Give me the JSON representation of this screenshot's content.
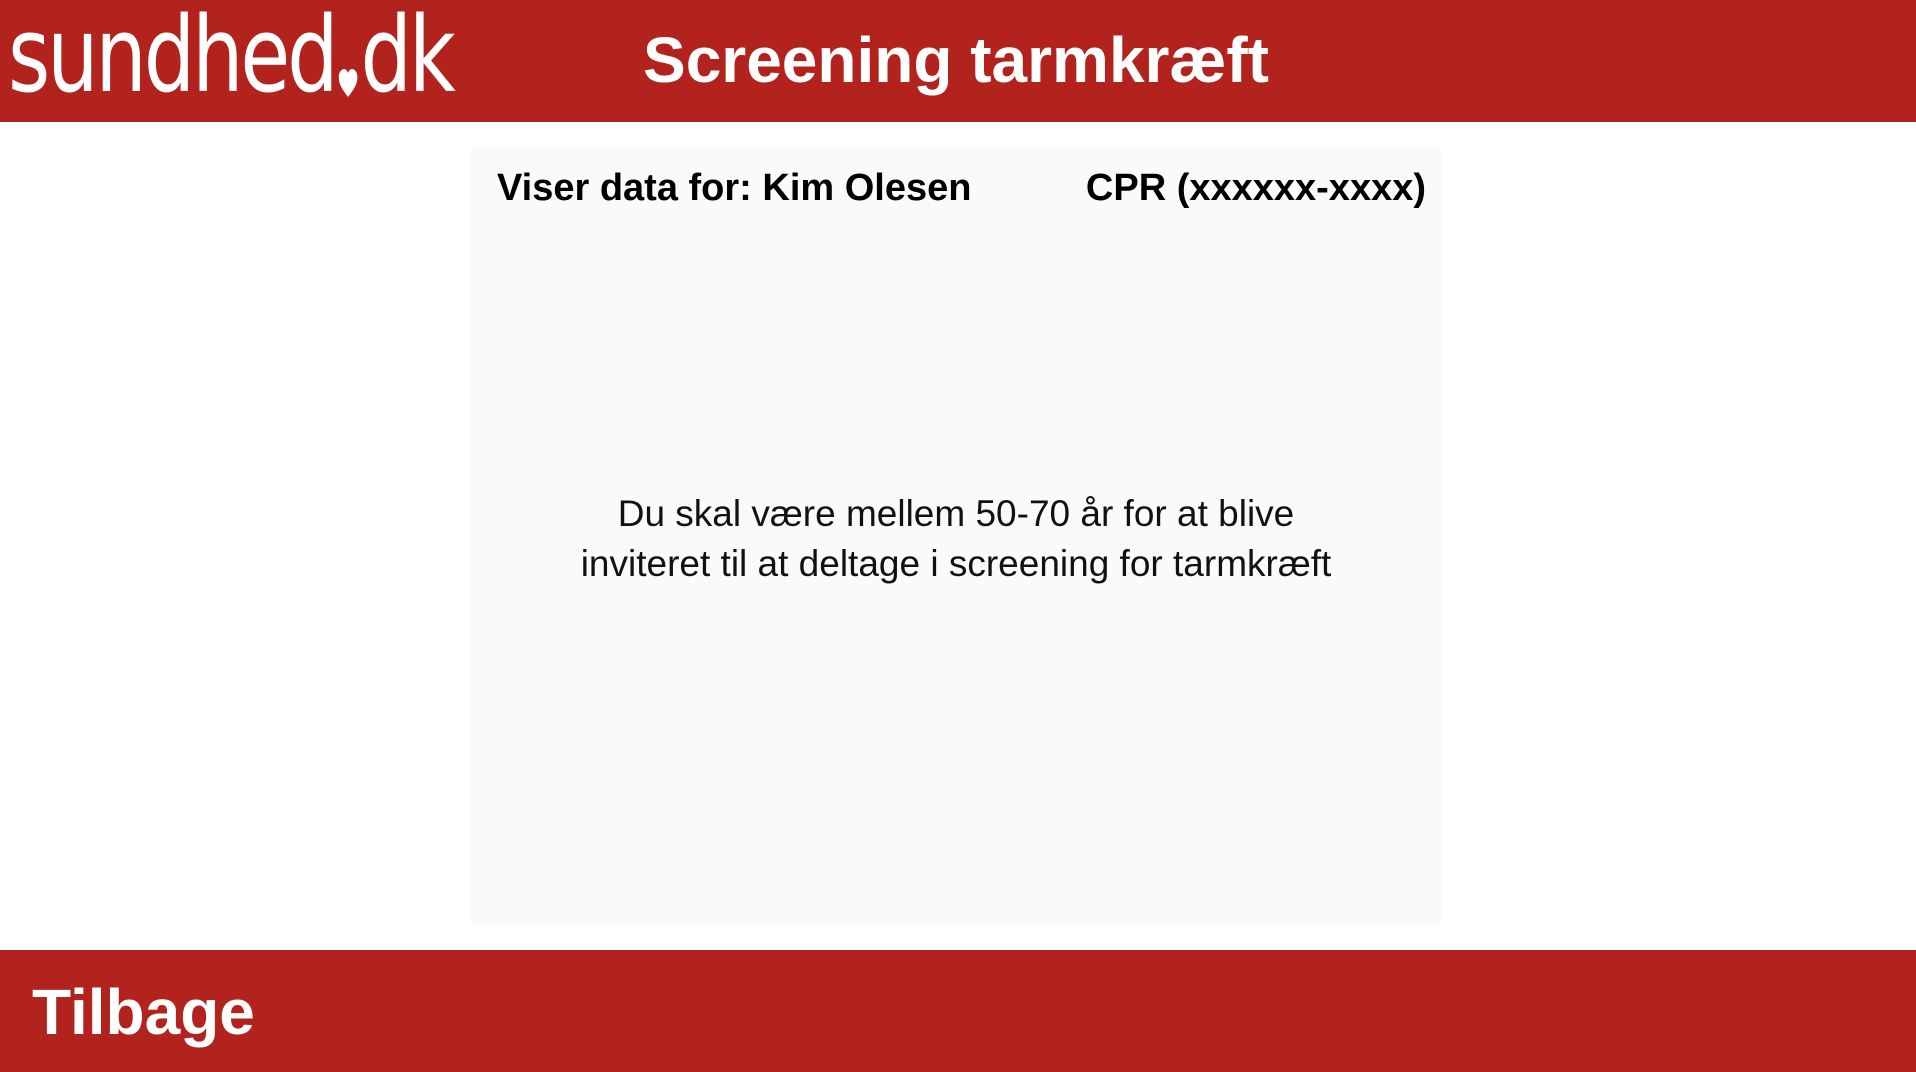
{
  "header": {
    "logo_text_left": "sundhed",
    "logo_text_right": "dk",
    "title": "Screening tarmkræft"
  },
  "patient": {
    "label": "Viser data for: Kim Olesen",
    "cpr": "CPR (xxxxxx-xxxx)"
  },
  "message": {
    "line1": "Du skal være mellem 50-70 år for at blive",
    "line2": "inviteret til at deltage i screening for tarmkræft"
  },
  "footer": {
    "back_label": "Tilbage"
  },
  "colors": {
    "brand_red": "#b3231e",
    "card_background": "#fafafa"
  }
}
